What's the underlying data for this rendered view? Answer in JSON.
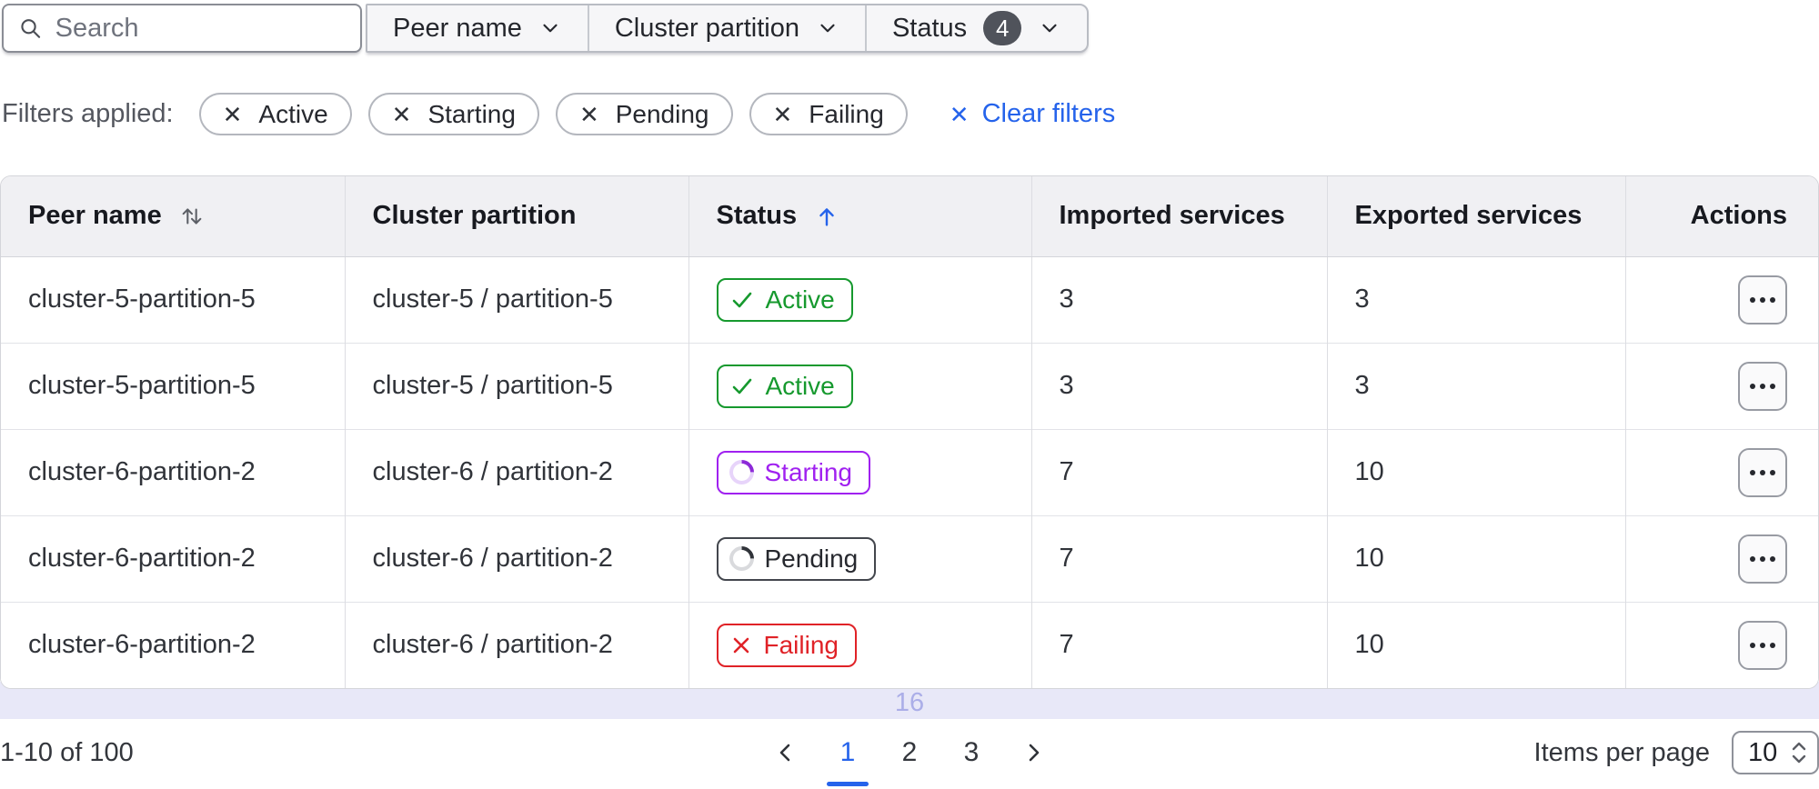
{
  "toolbar": {
    "search_placeholder": "Search",
    "dropdowns": [
      {
        "label": "Peer name"
      },
      {
        "label": "Cluster partition"
      },
      {
        "label": "Status",
        "badge": "4"
      }
    ]
  },
  "filters_applied": {
    "label": "Filters applied:",
    "chips": [
      "Active",
      "Starting",
      "Pending",
      "Failing"
    ],
    "clear_label": "Clear filters"
  },
  "table": {
    "columns": [
      "Peer name",
      "Cluster partition",
      "Status",
      "Imported services",
      "Exported services",
      "Actions"
    ],
    "sort": {
      "peer_name": "unsorted",
      "status": "ascending"
    },
    "rows": [
      {
        "peer_name": "cluster-5-partition-5",
        "cluster_partition": "cluster-5 / partition-5",
        "status": "Active",
        "imported": "3",
        "exported": "3"
      },
      {
        "peer_name": "cluster-5-partition-5",
        "cluster_partition": "cluster-5 / partition-5",
        "status": "Active",
        "imported": "3",
        "exported": "3"
      },
      {
        "peer_name": "cluster-6-partition-2",
        "cluster_partition": "cluster-6 / partition-2",
        "status": "Starting",
        "imported": "7",
        "exported": "10"
      },
      {
        "peer_name": "cluster-6-partition-2",
        "cluster_partition": "cluster-6 / partition-2",
        "status": "Pending",
        "imported": "7",
        "exported": "10"
      },
      {
        "peer_name": "cluster-6-partition-2",
        "cluster_partition": "cluster-6 / partition-2",
        "status": "Failing",
        "imported": "7",
        "exported": "10"
      }
    ]
  },
  "scroll_indicator": "16",
  "pagination": {
    "range_label": "1-10 of 100",
    "pages": [
      "1",
      "2",
      "3"
    ],
    "active_page": "1",
    "items_per_page_label": "Items per page",
    "items_per_page_value": "10"
  },
  "icons": {
    "remove": "✕"
  },
  "colors": {
    "accent_blue": "#2563eb",
    "success_green": "#16992e",
    "starting_purple": "#a021f0",
    "failing_red": "#e02227",
    "pending_gray": "#43464d",
    "count_badge_bg": "#50535b",
    "scroll_strip_bg": "#e8e8f8",
    "scroll_strip_text": "#abaee8",
    "header_bg": "#f0f0f3"
  }
}
